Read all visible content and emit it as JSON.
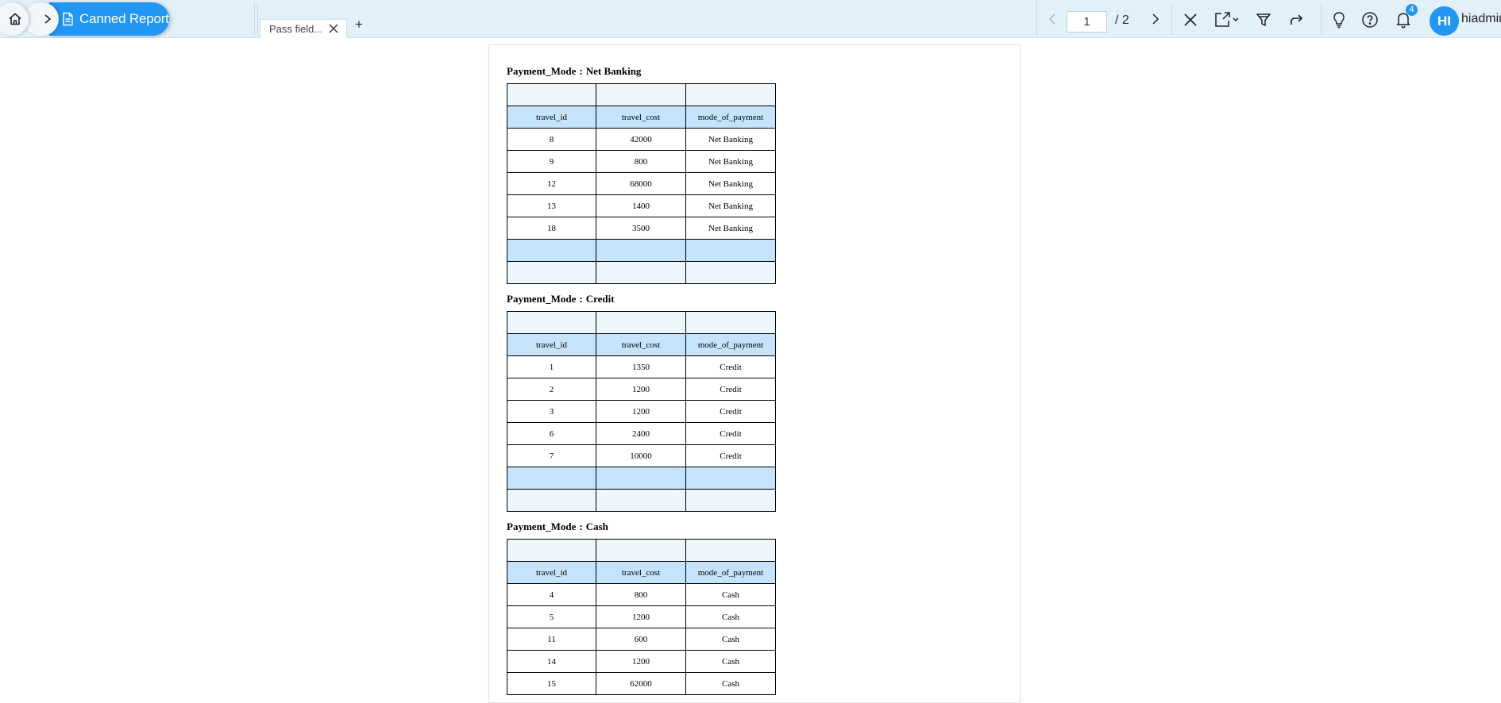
{
  "topbar": {
    "breadcrumb_label": "Canned Report",
    "tab_label": "Pass field...",
    "tab_add": "+",
    "page_current": "1",
    "page_total": "/ 2",
    "notification_count": "4",
    "avatar_initials": "HI",
    "username": "hiadmin",
    "accent_color": "#2196f3",
    "icons": [
      "home-icon",
      "chevron-right-icon",
      "document-icon",
      "close-icon",
      "export-icon",
      "filter-icon",
      "share-icon",
      "lightbulb-icon",
      "help-icon",
      "bell-icon"
    ]
  },
  "report": {
    "groups": [
      {
        "field": "Payment_Mode",
        "separator": ":",
        "value": "Net Banking",
        "headers": [
          "travel_id",
          "travel_cost",
          "mode_of_payment"
        ],
        "rows": [
          [
            "8",
            "42000",
            "Net Banking"
          ],
          [
            "9",
            "800",
            "Net Banking"
          ],
          [
            "12",
            "68000",
            "Net Banking"
          ],
          [
            "13",
            "1400",
            "Net Banking"
          ],
          [
            "18",
            "3500",
            "Net Banking"
          ]
        ]
      },
      {
        "field": "Payment_Mode",
        "separator": ":",
        "value": "Credit",
        "headers": [
          "travel_id",
          "travel_cost",
          "mode_of_payment"
        ],
        "rows": [
          [
            "1",
            "1350",
            "Credit"
          ],
          [
            "2",
            "1200",
            "Credit"
          ],
          [
            "3",
            "1200",
            "Credit"
          ],
          [
            "6",
            "2400",
            "Credit"
          ],
          [
            "7",
            "10000",
            "Credit"
          ]
        ]
      },
      {
        "field": "Payment_Mode",
        "separator": ":",
        "value": "Cash",
        "headers": [
          "travel_id",
          "travel_cost",
          "mode_of_payment"
        ],
        "rows": [
          [
            "4",
            "800",
            "Cash"
          ],
          [
            "5",
            "1200",
            "Cash"
          ],
          [
            "11",
            "600",
            "Cash"
          ],
          [
            "14",
            "1200",
            "Cash"
          ],
          [
            "15",
            "62000",
            "Cash"
          ]
        ]
      }
    ]
  }
}
